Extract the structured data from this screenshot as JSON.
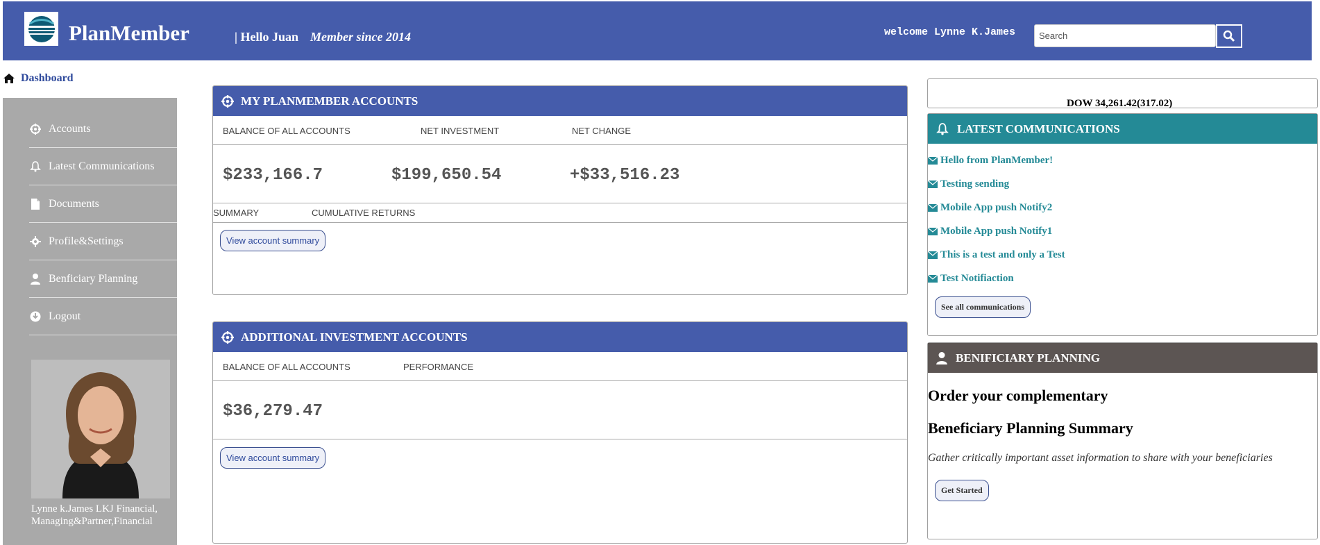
{
  "header": {
    "brand": "PlanMember",
    "hello": "| Hello Juan",
    "member_since": "Member since 2014",
    "welcome": "welcome Lynne K.James",
    "search_placeholder": "Search"
  },
  "breadcrumb": {
    "label": "Dashboard"
  },
  "sidebar": {
    "items": [
      {
        "label": "Accounts",
        "icon": "crosshair-icon"
      },
      {
        "label": "Latest Communications",
        "icon": "bell-icon"
      },
      {
        "label": "Documents",
        "icon": "document-icon"
      },
      {
        "label": "Profile&Settings",
        "icon": "gear-icon"
      },
      {
        "label": "Benficiary Planning",
        "icon": "user-icon"
      },
      {
        "label": "Logout",
        "icon": "logout-icon"
      }
    ],
    "advisor_caption": "Lynne k.James LKJ Financial, Managing&Partner,Financial"
  },
  "my_accounts": {
    "title": "MY PLANMEMBER ACCOUNTS",
    "labels": [
      "BALANCE  OF ALL  ACCOUNTS",
      "NET INVESTMENT",
      "NET CHANGE"
    ],
    "values": [
      "$233,166.7",
      "$199,650.54",
      "+$33,516.23"
    ],
    "tabs": [
      "SUMMARY",
      "CUMULATIVE RETURNS"
    ],
    "button": "View account summary"
  },
  "additional_accounts": {
    "title": "ADDITIONAL INVESTMENT ACCOUNTS",
    "labels": [
      "BALANCE  OF ALL  ACCOUNTS",
      "PERFORMANCE"
    ],
    "values": [
      "$36,279.47"
    ],
    "button": "View account summary"
  },
  "dow": "DOW 34,261.42(317.02)",
  "communications": {
    "title": "LATEST COMMUNICATIONS",
    "items": [
      " Hello from PlanMember!",
      " Testing sending",
      "Mobile App push Notify2",
      "Mobile App push Notify1",
      "This is a test and only a Test",
      "Test Notifiaction"
    ],
    "button": "See all communications"
  },
  "beneficiary": {
    "title": "BENIFICIARY PLANNING",
    "heading1": "Order your complementary",
    "heading2": "Beneficiary Planning Summary",
    "description": "Gather critically important asset information to share with your beneficiaries",
    "button": "Get Started"
  },
  "colors": {
    "header": "#455cab",
    "communications_header": "#248a96",
    "beneficiary_header": "#5c5553",
    "sidebar": "#a9a9a9"
  }
}
